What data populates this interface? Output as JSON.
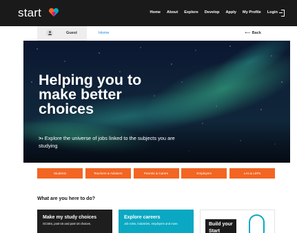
{
  "header": {
    "logo_text": "start",
    "nav": [
      {
        "label": "Home"
      },
      {
        "label": "About"
      },
      {
        "label": "Explore"
      },
      {
        "label": "Develop"
      },
      {
        "label": "Apply"
      },
      {
        "label": "My Profile"
      }
    ],
    "login_label": "Login",
    "colors": {
      "background": "#1a1a1a",
      "logo_accent_1": "#f26522",
      "logo_accent_2": "#0aa8c2",
      "logo_accent_3": "#e6007e"
    }
  },
  "subbar": {
    "user_label": "Guest",
    "breadcrumb": "Home",
    "back_label": "Back"
  },
  "hero": {
    "title_lines": [
      "Helping you to",
      "make better",
      "choices"
    ],
    "subtitle_prefix": ">›",
    "subtitle": "Explore the universe of jobs linked to the subjects you are studying"
  },
  "audience_buttons": [
    {
      "label": "Students"
    },
    {
      "label": "Teachers & Advisers"
    },
    {
      "label": "Parents & Carers"
    },
    {
      "label": "Employers"
    },
    {
      "label": "LAs & LEPs"
    }
  ],
  "section": {
    "title": "What are you here to do?"
  },
  "cards": [
    {
      "title": "Make my study choices",
      "desc": "GCSEs, post-16 and post-18 choices."
    },
    {
      "title": "Explore careers",
      "desc": "Job roles, industries, employers and more."
    },
    {
      "title": "Build your Start Profile"
    }
  ],
  "colors": {
    "accent_orange": "#f26522",
    "accent_teal": "#0aa8c2",
    "link_blue": "#1e88e5"
  }
}
